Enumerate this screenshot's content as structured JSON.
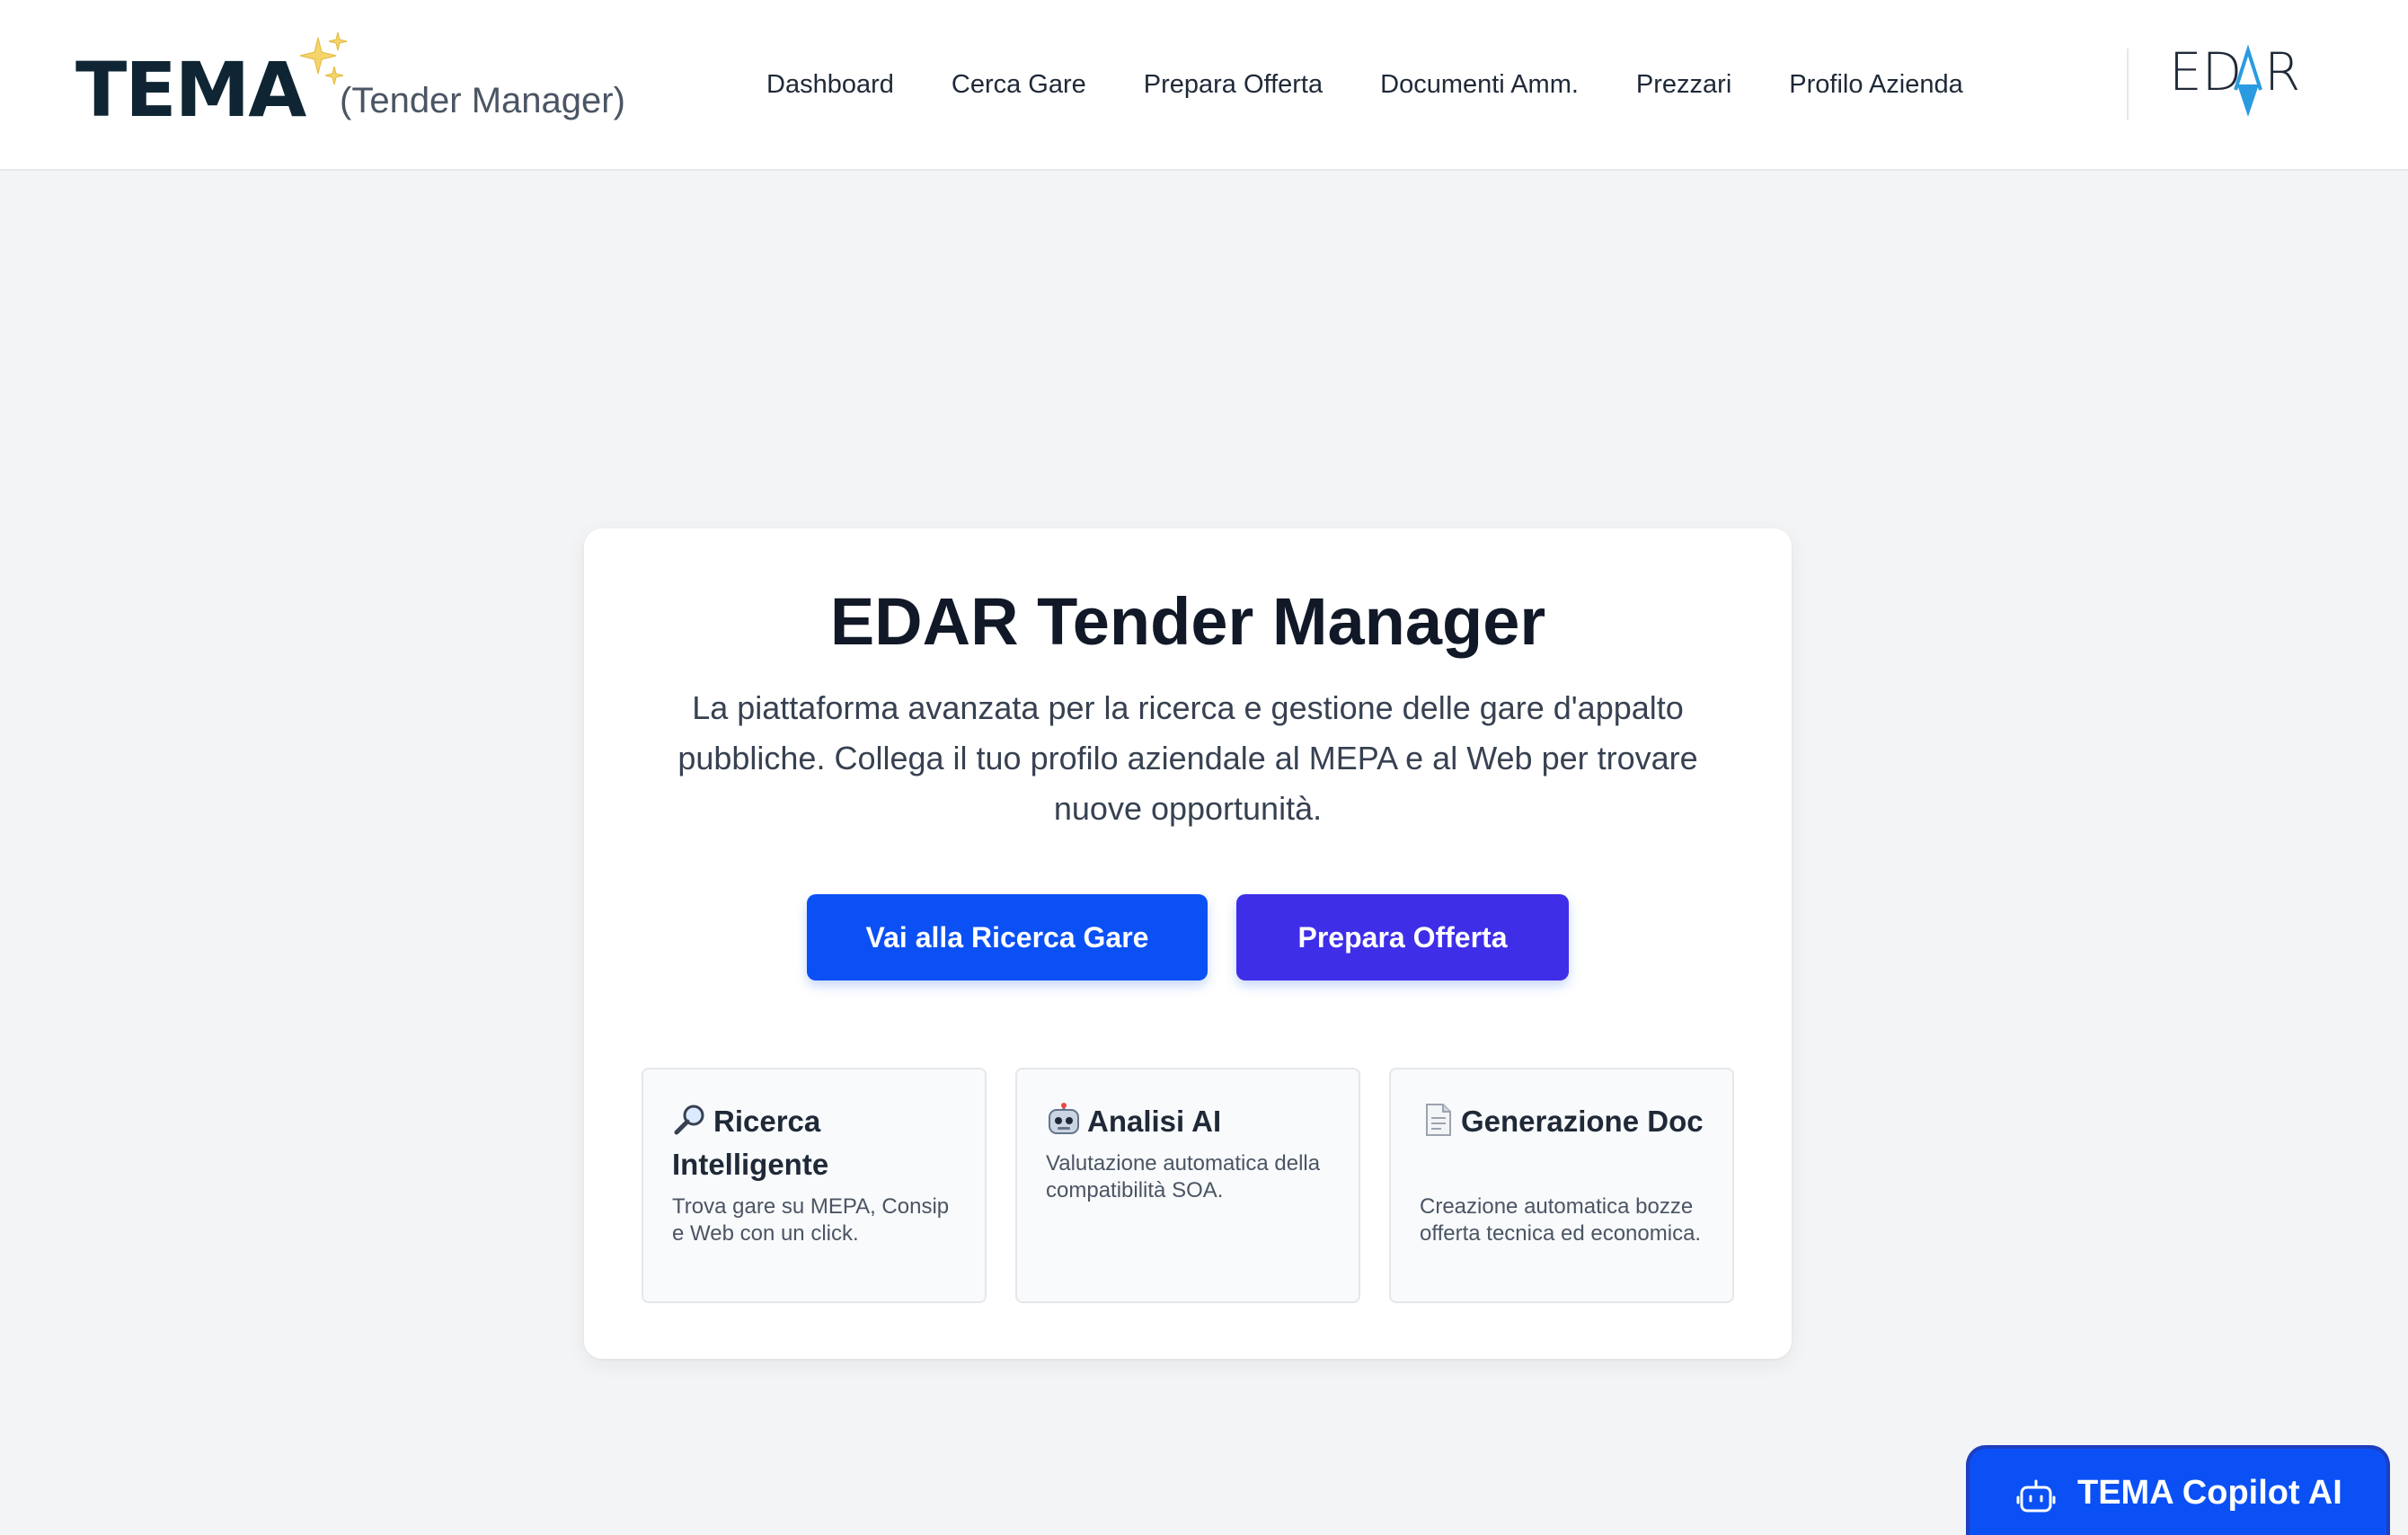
{
  "header": {
    "logo_text": "TEMA",
    "logo_subtitle": "(Tender Manager)",
    "nav": [
      "Dashboard",
      "Cerca Gare",
      "Prepara Offerta",
      "Documenti Amm.",
      "Prezzari",
      "Profilo Azienda"
    ],
    "brand_logo": "EDAR"
  },
  "hero": {
    "title": "EDAR Tender Manager",
    "description": "La piattaforma avanzata per la ricerca e gestione delle gare d'appalto pubbliche. Collega il tuo profilo aziendale al MEPA e al Web per trovare nuove opportunità.",
    "primary_button": "Vai alla Ricerca Gare",
    "secondary_button": "Prepara Offerta"
  },
  "features": [
    {
      "icon": "magnifier-icon",
      "title": "Ricerca Intelligente",
      "text": "Trova gare su MEPA, Consip e Web con un click."
    },
    {
      "icon": "robot-icon",
      "title": "Analisi AI",
      "text": "Valutazione automatica della compatibilità SOA."
    },
    {
      "icon": "document-icon",
      "title": "Generazione Doc",
      "text": "Creazione automatica bozze offerta tecnica ed economica."
    }
  ],
  "copilot": {
    "label": "TEMA Copilot AI"
  },
  "colors": {
    "primary": "#0a50f5",
    "secondary": "#3f2ee8",
    "brand_accent": "#2a9be0",
    "logo_dark": "#0f2533"
  }
}
